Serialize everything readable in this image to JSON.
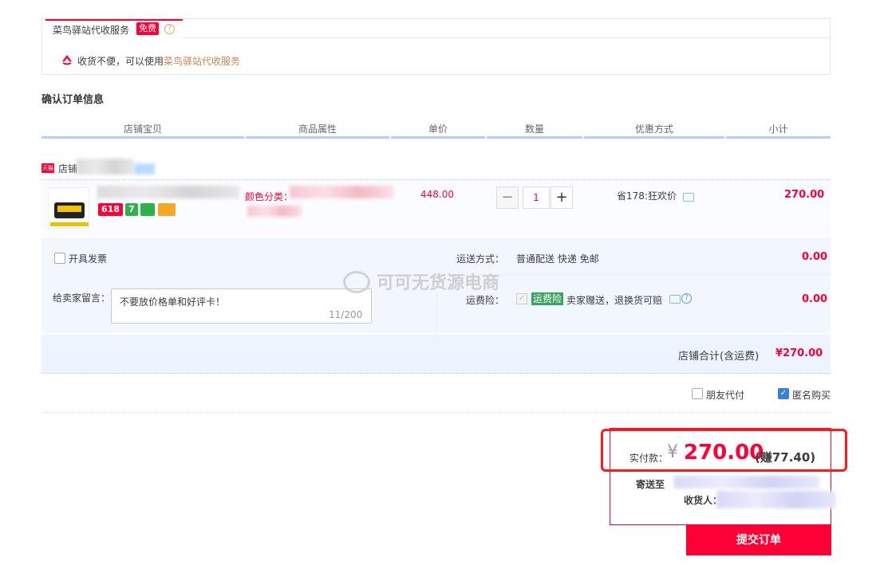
{
  "service": {
    "title": "菜鸟驿站代收服务",
    "free_badge": "免费",
    "help": "?",
    "note_prefix": "收货不便，可以使用",
    "note_link": "菜鸟驿站代收服务"
  },
  "section_title": "确认订单信息",
  "columns": [
    "店铺宝贝",
    "商品属性",
    "单价",
    "数量",
    "优惠方式",
    "小计"
  ],
  "shop": {
    "tag": "天猫",
    "name": "店铺"
  },
  "item": {
    "badges": [
      "618",
      "7",
      "",
      ""
    ],
    "attr_label": "颜色分类：",
    "price": "448.00",
    "qty_minus": "−",
    "qty": "1",
    "qty_plus": "+",
    "promo": "省178:狂欢价",
    "subtotal": "270.00"
  },
  "options": {
    "invoice": "开具发票",
    "shipping_label": "运送方式：",
    "shipping_value": "普通配送 快递 免邮",
    "shipping_amount": "0.00",
    "memo_label": "给卖家留言：",
    "memo_text": "不要放价格单和好评卡！",
    "memo_count": "11/200",
    "insurance_label": "运费险：",
    "insurance_badge": "运费险",
    "insurance_text": "卖家赠送，退换货可赔",
    "insurance_amount": "0.00",
    "shop_total_label": "店铺合计(含运费)",
    "shop_total": "¥270.00"
  },
  "extras": {
    "friend_pay": "朋友代付",
    "anonymous": "匿名购买",
    "anonymous_checked": true
  },
  "payment": {
    "label": "实付款：",
    "yen": "¥",
    "amount": "270.00",
    "earn": "(赚77.40)",
    "ship_to": "寄送至",
    "receiver": "收货人：",
    "submit": "提交订单"
  },
  "watermark": "可可无货源电商",
  "colors": {
    "accent": "#ff0036",
    "header_line": "#b2d1ff",
    "option_bg": "#f2f7ff"
  }
}
